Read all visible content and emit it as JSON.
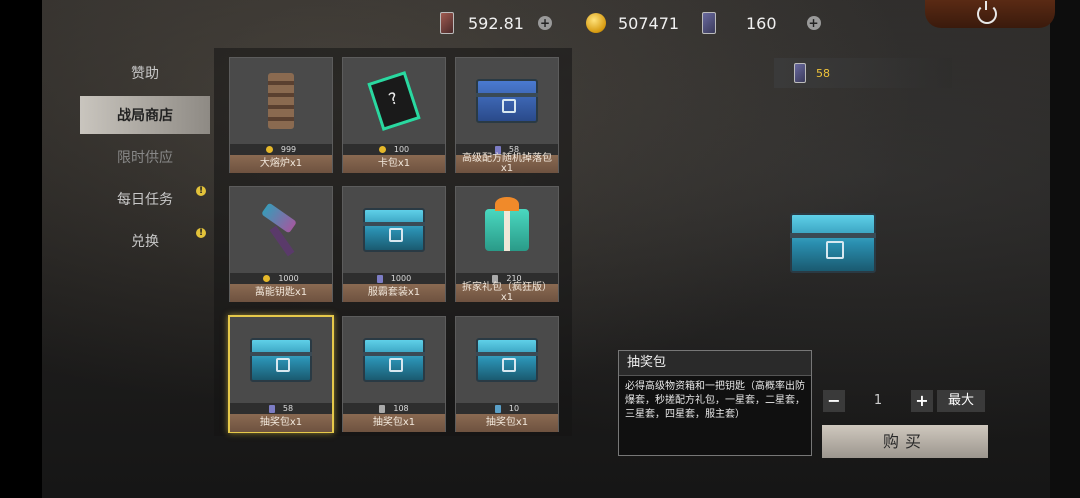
{
  "currency": {
    "item1": {
      "value": "592.81",
      "icon": "red-card-icon"
    },
    "coins": {
      "value": "507471",
      "icon": "gold-coin-icon"
    },
    "cards": {
      "value": "160",
      "icon": "card-icon"
    }
  },
  "nav": {
    "items": [
      {
        "label": "赞助"
      },
      {
        "label": "战局商店"
      },
      {
        "label": "限时供应"
      },
      {
        "label": "每日任务"
      },
      {
        "label": "兑换"
      }
    ],
    "alert_symbol": "!"
  },
  "shop": {
    "items": [
      {
        "name": "大熔炉x1",
        "price": "999",
        "currency_icon": "coin"
      },
      {
        "name": "卡包x1",
        "price": "100",
        "currency_icon": "coin"
      },
      {
        "name": "高级配方随机掉落包x1",
        "price": "58",
        "currency_icon": "card"
      },
      {
        "name": "萬能钥匙x1",
        "price": "1000",
        "currency_icon": "coin"
      },
      {
        "name": "服霸套装x1",
        "price": "1000",
        "currency_icon": "card"
      },
      {
        "name": "拆家礼包（疯狂版）x1",
        "price": "210",
        "currency_icon": "gray-card"
      },
      {
        "name": "抽奖包x1",
        "price": "58",
        "currency_icon": "card"
      },
      {
        "name": "抽奖包x1",
        "price": "108",
        "currency_icon": "gray-card"
      },
      {
        "name": "抽奖包x1",
        "price": "10",
        "currency_icon": "key"
      }
    ]
  },
  "detail": {
    "balance": "58",
    "title": "抽奖包",
    "description": "必得高级物资箱和一把钥匙（高概率出防爆套，秒搓配方礼包，一星套，二星套，三星套，四星套，服主套）",
    "quantity": "1",
    "minus": "−",
    "plus": "+",
    "max_label": "最大",
    "buy_label": "购买"
  },
  "colors": {
    "selected_border": "#e6c94a",
    "balance_text": "#f0c43a"
  }
}
